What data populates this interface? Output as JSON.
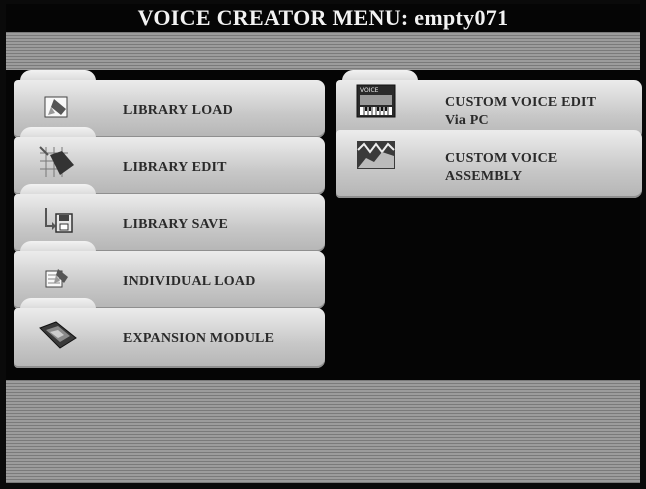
{
  "window": {
    "title": "VOICE CREATOR MENU: empty071"
  },
  "left_menu": {
    "items": [
      {
        "label": "LIBRARY LOAD",
        "icon": "library-load-icon"
      },
      {
        "label": "LIBRARY EDIT",
        "icon": "library-edit-icon"
      },
      {
        "label": "LIBRARY SAVE",
        "icon": "floppy-disk-icon"
      },
      {
        "label": "INDIVIDUAL LOAD",
        "icon": "individual-load-icon"
      },
      {
        "label": "EXPANSION MODULE",
        "icon": "expansion-module-icon"
      }
    ]
  },
  "right_menu": {
    "items": [
      {
        "label_line1": "CUSTOM VOICE EDIT",
        "label_line2": "Via PC",
        "icon": "voice-keyboard-icon",
        "icon_text": "VOICE"
      },
      {
        "label_line1": "CUSTOM VOICE",
        "label_line2": "ASSEMBLY",
        "icon": "waveform-icon"
      }
    ]
  },
  "colors": {
    "background": "#050505",
    "title_text": "#f2f2f2",
    "tab_face": "#d8d8d8",
    "tab_text": "#2a2a2a",
    "stripe_band": "#8c8c8c"
  }
}
